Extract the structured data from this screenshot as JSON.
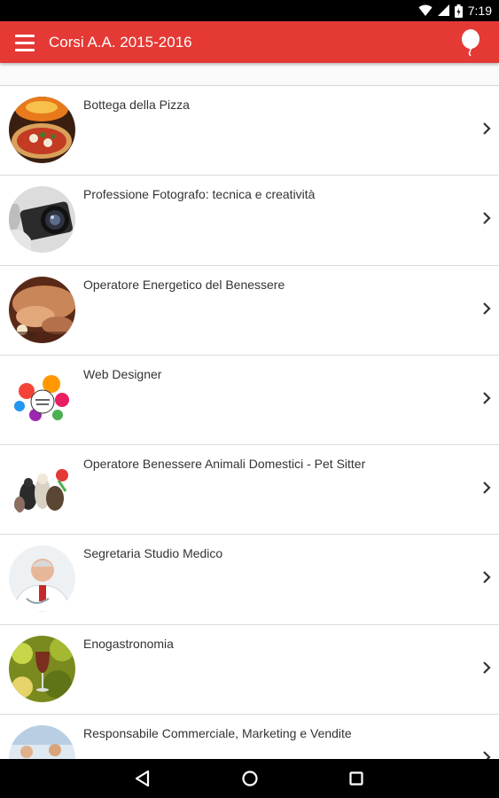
{
  "status_bar": {
    "time": "7:19",
    "icons": [
      "wifi-icon",
      "cell-signal-icon",
      "battery-icon"
    ]
  },
  "app_bar": {
    "title": "Corsi A.A. 2015-2016",
    "menu_icon": "hamburger-menu-icon",
    "action_icon": "balloon-icon",
    "color": "#e53935"
  },
  "courses": [
    {
      "title": "Bottega della Pizza",
      "thumb": "pizza-image"
    },
    {
      "title": "Professione Fotografo: tecnica e creatività",
      "thumb": "camera-image"
    },
    {
      "title": "Operatore Energetico del Benessere",
      "thumb": "massage-image"
    },
    {
      "title": "Web Designer",
      "thumb": "web-design-image"
    },
    {
      "title": "Operatore Benessere Animali Domestici - Pet Sitter",
      "thumb": "pets-image"
    },
    {
      "title": "Segretaria Studio Medico",
      "thumb": "doctor-image"
    },
    {
      "title": "Enogastronomia",
      "thumb": "wine-image"
    },
    {
      "title": "Responsabile Commerciale, Marketing e Vendite",
      "thumb": "business-image"
    }
  ],
  "nav_bar": {
    "buttons": [
      "back-icon",
      "home-icon",
      "recents-icon"
    ]
  }
}
